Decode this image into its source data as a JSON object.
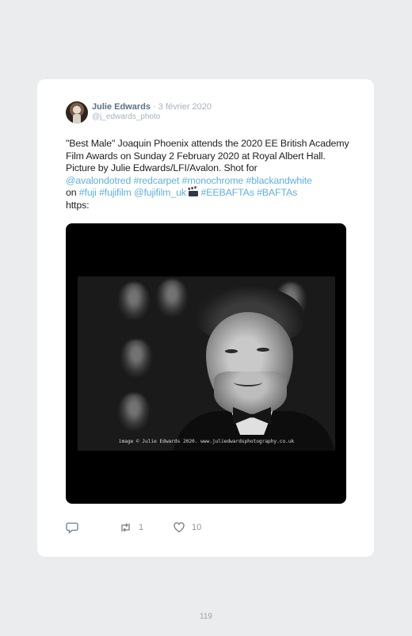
{
  "tweet": {
    "author_name": "Julie Edwards",
    "date": "· 3 février 2020",
    "handle": "@j_edwards_photo",
    "text": {
      "quote_opening": "\"Best Male\" Joaquin Phoenix attends the 2020 EE British Academy Film Awards on Sunday 2 February 2020 at Royal Albert Hall. Picture by Julie Edwards/LFI/Avalon. Shot for",
      "links_line1": [
        "@avalondotred",
        "#redcarpet",
        "#monochrome",
        "#blackandwhite"
      ],
      "on_word": "on",
      "links_line2": [
        "#fuji",
        "#fujifilm",
        "@fujifilm_uk"
      ],
      "emoji_icon": "clapper-board-icon",
      "links_line3": [
        "#EEBAFTAs",
        "#BAFTAs"
      ],
      "trailing": "https:"
    },
    "media": {
      "watermark": "image © Julie Edwards 2020. www.juliedwardsphotography.co.uk"
    },
    "actions": {
      "reply_icon": "comment-icon",
      "retweet_icon": "retweet-icon",
      "retweet_count": "1",
      "like_icon": "heart-icon",
      "like_count": "10"
    },
    "colors": {
      "link": "#5fb0e0",
      "name": "#5b6f84",
      "muted": "#a7b2bd",
      "background": "#ebecee"
    }
  },
  "page": {
    "number": "119"
  }
}
